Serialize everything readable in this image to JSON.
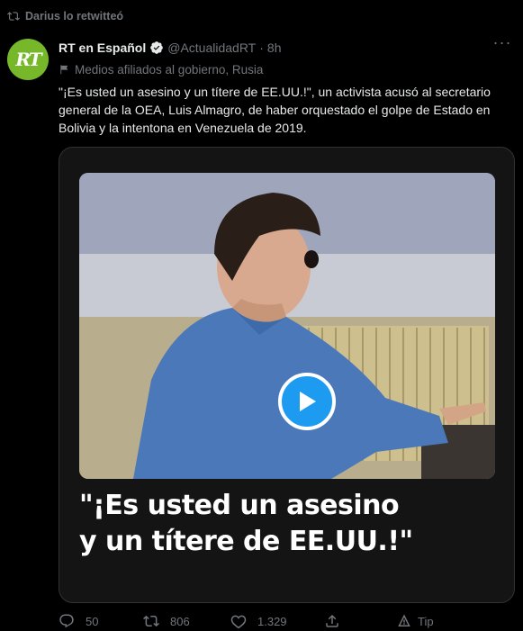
{
  "retweet": {
    "icon": "retweet-icon",
    "text": "Darius lo retwitteó"
  },
  "author": {
    "avatar_text": "RT",
    "avatar_color": "#77b82a",
    "display_name": "RT en Español",
    "handle": "@ActualidadRT",
    "separator": "·",
    "time": "8h",
    "verified_icon": "verified-badge-icon",
    "label": "Medios afiliados al gobierno, Rusia",
    "label_icon": "government-flag-icon"
  },
  "tweet": {
    "text": "\"¡Es usted un asesino y un títere de EE.UU.!\", un activista acusó al secretario general de la OEA, Luis Almagro, de haber orquestado el golpe de Estado en Bolivia y la intentona en Venezuela de 2019."
  },
  "media": {
    "caption_line1": "\"¡Es usted un asesino",
    "caption_line2": "y un títere de EE.UU.!\"",
    "play_icon": "play-icon",
    "accent": "#1d9bf0"
  },
  "actions": {
    "reply": {
      "icon": "reply-icon",
      "count": "50"
    },
    "retweet": {
      "icon": "retweet-icon",
      "count": "806"
    },
    "like": {
      "icon": "heart-icon",
      "count": "1.329"
    },
    "share": {
      "icon": "share-icon"
    },
    "tip": {
      "icon": "tip-icon",
      "label": "Tip"
    }
  },
  "colors": {
    "background": "#000000",
    "text": "#e7e9ea",
    "secondary": "#71767b"
  }
}
